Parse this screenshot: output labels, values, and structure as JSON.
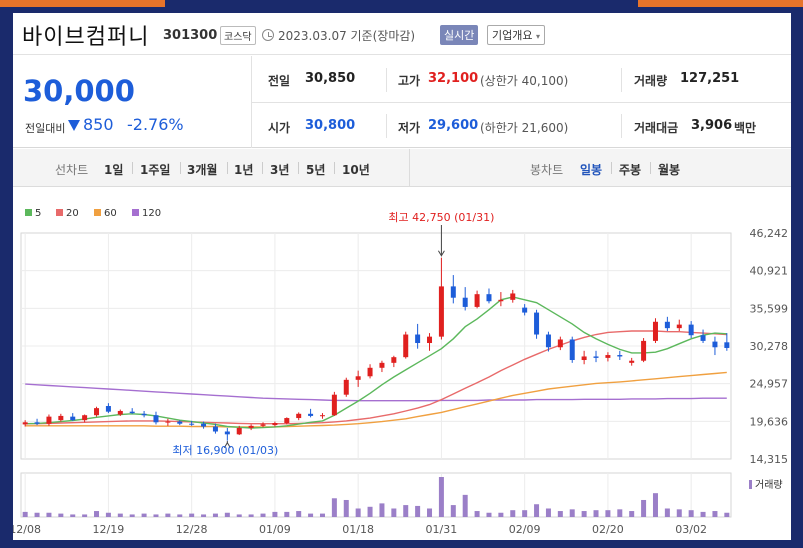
{
  "header": {
    "company_name": "바이브컴퍼니",
    "code": "301300",
    "market_badge": "코스닥",
    "date_text": "2023.03.07 기준(장마감)",
    "realtime_label": "실시간",
    "overview_label": "기업개요"
  },
  "quote": {
    "price": "30,000",
    "change_label": "전일대비",
    "change_value": "850",
    "change_pct": "-2.76%",
    "prev_close_label": "전일",
    "prev_close": "30,850",
    "high_label": "고가",
    "high": "32,100",
    "high_limit": "(상한가 40,100)",
    "volume_label": "거래량",
    "volume": "127,251",
    "open_label": "시가",
    "open": "30,800",
    "low_label": "저가",
    "low": "29,600",
    "low_limit": "(하한가 21,600)",
    "amount_label": "거래대금",
    "amount": "3,906",
    "amount_unit": "백만"
  },
  "periods": {
    "line_label": "선차트",
    "line_items": [
      "1일",
      "1주일",
      "3개월",
      "1년",
      "3년",
      "5년",
      "10년"
    ],
    "candle_label": "봉차트",
    "candle_items": [
      "일봉",
      "주봉",
      "월봉"
    ],
    "active_candle": "일봉"
  },
  "colors": {
    "up": "#e0201f",
    "down": "#1d5dd9",
    "ma5": "#5cb85c",
    "ma20": "#e86a6a",
    "ma60": "#f0a040",
    "ma120": "#a56fd0",
    "volume": "#9b7fc8"
  },
  "chart_data": {
    "type": "candlestick",
    "legend": [
      {
        "name": "5",
        "color": "#5cb85c"
      },
      {
        "name": "20",
        "color": "#e86a6a"
      },
      {
        "name": "60",
        "color": "#f0a040"
      },
      {
        "name": "120",
        "color": "#a56fd0"
      }
    ],
    "y_ticks": [
      "46,242",
      "40,921",
      "35,599",
      "30,278",
      "24,957",
      "19,636",
      "14,315"
    ],
    "y_range": [
      14315,
      46242
    ],
    "x_ticks": [
      {
        "label": "12/08",
        "i": 0
      },
      {
        "label": "12/19",
        "i": 7
      },
      {
        "label": "12/28",
        "i": 14
      },
      {
        "label": "01/09",
        "i": 21
      },
      {
        "label": "01/18",
        "i": 28
      },
      {
        "label": "01/31",
        "i": 35
      },
      {
        "label": "02/09",
        "i": 42
      },
      {
        "label": "02/20",
        "i": 49
      },
      {
        "label": "03/02",
        "i": 56
      }
    ],
    "max_annotation": "최고 42,750 (01/31)",
    "min_annotation": "최저 16,900 (01/03)",
    "max_index": 35,
    "min_index": 17,
    "volume_label": "거래량",
    "candles": [
      [
        19200,
        19800,
        18900,
        19500
      ],
      [
        19500,
        20000,
        19100,
        19300
      ],
      [
        19300,
        20600,
        19000,
        20300
      ],
      [
        19800,
        20700,
        19600,
        20400
      ],
      [
        20300,
        20800,
        19700,
        19800
      ],
      [
        19800,
        20600,
        19500,
        20500
      ],
      [
        20500,
        21700,
        20300,
        21500
      ],
      [
        21800,
        22200,
        20800,
        21000
      ],
      [
        20600,
        21300,
        20400,
        21100
      ],
      [
        21000,
        21500,
        20700,
        20800
      ],
      [
        20700,
        21100,
        20200,
        20500
      ],
      [
        20500,
        21000,
        19200,
        19500
      ],
      [
        19500,
        20000,
        19000,
        19600
      ],
      [
        19600,
        19800,
        19100,
        19300
      ],
      [
        19300,
        19700,
        19000,
        19200
      ],
      [
        19300,
        19600,
        18600,
        18900
      ],
      [
        18900,
        19300,
        17900,
        18200
      ],
      [
        18200,
        18700,
        16900,
        17800
      ],
      [
        17800,
        19000,
        17700,
        18700
      ],
      [
        18700,
        19200,
        18400,
        19000
      ],
      [
        19000,
        19500,
        18800,
        19200
      ],
      [
        19100,
        19600,
        18900,
        19400
      ],
      [
        19400,
        20200,
        19200,
        20100
      ],
      [
        20100,
        20900,
        19800,
        20700
      ],
      [
        20700,
        21400,
        20200,
        20400
      ],
      [
        20400,
        20800,
        20000,
        20500
      ],
      [
        20500,
        23800,
        20400,
        23400
      ],
      [
        23400,
        25800,
        23100,
        25500
      ],
      [
        25500,
        26800,
        24500,
        26000
      ],
      [
        26000,
        27700,
        25700,
        27200
      ],
      [
        27200,
        28200,
        26600,
        27900
      ],
      [
        27900,
        28900,
        27300,
        28700
      ],
      [
        28700,
        32300,
        28500,
        31900
      ],
      [
        31900,
        33400,
        29900,
        30700
      ],
      [
        30700,
        32100,
        29600,
        31600
      ],
      [
        31600,
        42750,
        31200,
        38700
      ],
      [
        38700,
        40300,
        36300,
        37100
      ],
      [
        37100,
        38600,
        35300,
        35800
      ],
      [
        35800,
        38100,
        35600,
        37600
      ],
      [
        37600,
        38400,
        36300,
        36600
      ],
      [
        36600,
        37900,
        35900,
        36800
      ],
      [
        36800,
        38200,
        36400,
        37700
      ],
      [
        35700,
        36200,
        34600,
        35000
      ],
      [
        35000,
        35400,
        31300,
        31900
      ],
      [
        31900,
        32300,
        29500,
        30100
      ],
      [
        30100,
        31600,
        29700,
        31200
      ],
      [
        31200,
        31600,
        27900,
        28300
      ],
      [
        28300,
        29600,
        27700,
        28800
      ],
      [
        28800,
        29600,
        28000,
        28600
      ],
      [
        28600,
        29400,
        28100,
        29000
      ],
      [
        29000,
        29600,
        28300,
        28800
      ],
      [
        27900,
        28600,
        27500,
        28200
      ],
      [
        28200,
        31400,
        28000,
        31000
      ],
      [
        31000,
        34200,
        30700,
        33700
      ],
      [
        33700,
        34400,
        32400,
        32800
      ],
      [
        32800,
        34000,
        32400,
        33300
      ],
      [
        33300,
        33800,
        31400,
        31800
      ],
      [
        31800,
        32600,
        30700,
        31000
      ],
      [
        30900,
        31600,
        29000,
        30100
      ],
      [
        30800,
        32100,
        29600,
        30000
      ]
    ],
    "volumes": [
      6,
      5,
      5,
      4,
      3,
      3,
      7,
      5,
      4,
      3,
      4,
      3,
      4,
      3,
      4,
      3,
      4,
      5,
      3,
      3,
      4,
      6,
      6,
      7,
      4,
      4,
      22,
      20,
      10,
      12,
      16,
      10,
      14,
      13,
      10,
      47,
      14,
      26,
      7,
      5,
      5,
      8,
      8,
      15,
      10,
      7,
      9,
      7,
      8,
      8,
      9,
      7,
      20,
      28,
      10,
      9,
      8,
      6,
      7,
      5
    ],
    "ma5": [
      19300,
      19350,
      19450,
      19600,
      19750,
      19950,
      20200,
      20400,
      20600,
      20700,
      20600,
      20400,
      20100,
      19800,
      19600,
      19400,
      19200,
      18900,
      18800,
      18700,
      18750,
      18850,
      19000,
      19250,
      19500,
      19700,
      20500,
      21500,
      22500,
      23600,
      24800,
      25900,
      26900,
      27900,
      28900,
      29900,
      31300,
      33000,
      34100,
      35400,
      36800,
      37200,
      36800,
      36400,
      35400,
      34400,
      33400,
      32200,
      31300,
      30500,
      29800,
      29300,
      29300,
      29400,
      29900,
      30600,
      31300,
      31800,
      32100,
      32000
    ],
    "ma20": [
      19300,
      19300,
      19350,
      19400,
      19450,
      19500,
      19550,
      19600,
      19650,
      19700,
      19700,
      19700,
      19650,
      19600,
      19550,
      19500,
      19450,
      19400,
      19350,
      19300,
      19300,
      19300,
      19300,
      19350,
      19400,
      19450,
      19550,
      19700,
      19900,
      20100,
      20400,
      20700,
      21100,
      21500,
      22000,
      22700,
      23500,
      24300,
      25100,
      25900,
      26800,
      27600,
      28400,
      29100,
      29800,
      30400,
      31000,
      31500,
      31900,
      32200,
      32300,
      32400,
      32400,
      32400,
      32300,
      32300,
      32200,
      32100,
      32000,
      31900
    ],
    "ma60": [
      19000,
      19000,
      19000,
      19000,
      19000,
      19000,
      19000,
      19000,
      19000,
      19000,
      19000,
      18950,
      18950,
      18950,
      18900,
      18900,
      18900,
      18850,
      18850,
      18850,
      18850,
      18850,
      18900,
      18950,
      19000,
      19050,
      19100,
      19200,
      19300,
      19450,
      19600,
      19800,
      20000,
      20300,
      20600,
      20900,
      21300,
      21700,
      22100,
      22500,
      22900,
      23300,
      23600,
      23900,
      24200,
      24400,
      24600,
      24800,
      25000,
      25100,
      25200,
      25350,
      25500,
      25650,
      25800,
      25950,
      26100,
      26250,
      26400,
      26550
    ],
    "ma120": [
      24900,
      24800,
      24700,
      24600,
      24500,
      24400,
      24300,
      24200,
      24100,
      24000,
      23900,
      23800,
      23700,
      23600,
      23500,
      23400,
      23300,
      23200,
      23100,
      23000,
      22900,
      22850,
      22800,
      22750,
      22700,
      22650,
      22600,
      22600,
      22550,
      22550,
      22550,
      22550,
      22550,
      22550,
      22550,
      22600,
      22600,
      22600,
      22600,
      22650,
      22650,
      22650,
      22650,
      22700,
      22700,
      22700,
      22700,
      22750,
      22750,
      22750,
      22750,
      22800,
      22800,
      22800,
      22850,
      22850,
      22850,
      22900,
      22900,
      22900
    ]
  }
}
